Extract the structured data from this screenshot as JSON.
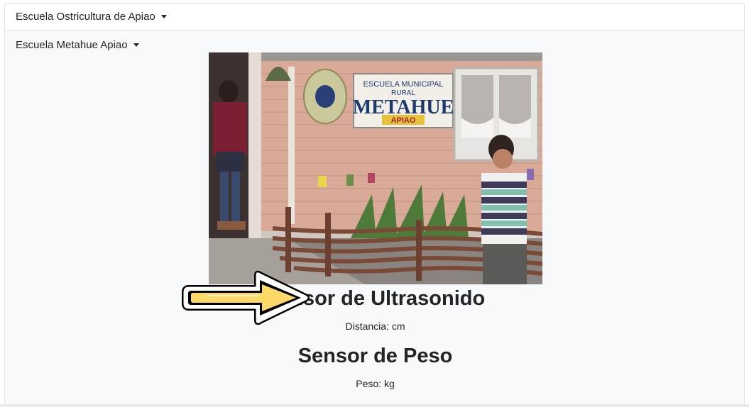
{
  "accordion": {
    "items": [
      {
        "label": "Escuela Ostricultura de Apiao"
      },
      {
        "label": "Escuela Metahue Apiao"
      }
    ]
  },
  "photo": {
    "sign_line1": "ESCUELA MUNICIPAL",
    "sign_line2": "RURAL",
    "sign_line3": "METAHUE",
    "sign_line4": "APIAO"
  },
  "sensors": {
    "ultrasonic": {
      "title": "Sensor de Ultrasonido",
      "reading": "Distancia: cm"
    },
    "weight": {
      "title": "Sensor de Peso",
      "reading": "Peso: kg"
    }
  }
}
